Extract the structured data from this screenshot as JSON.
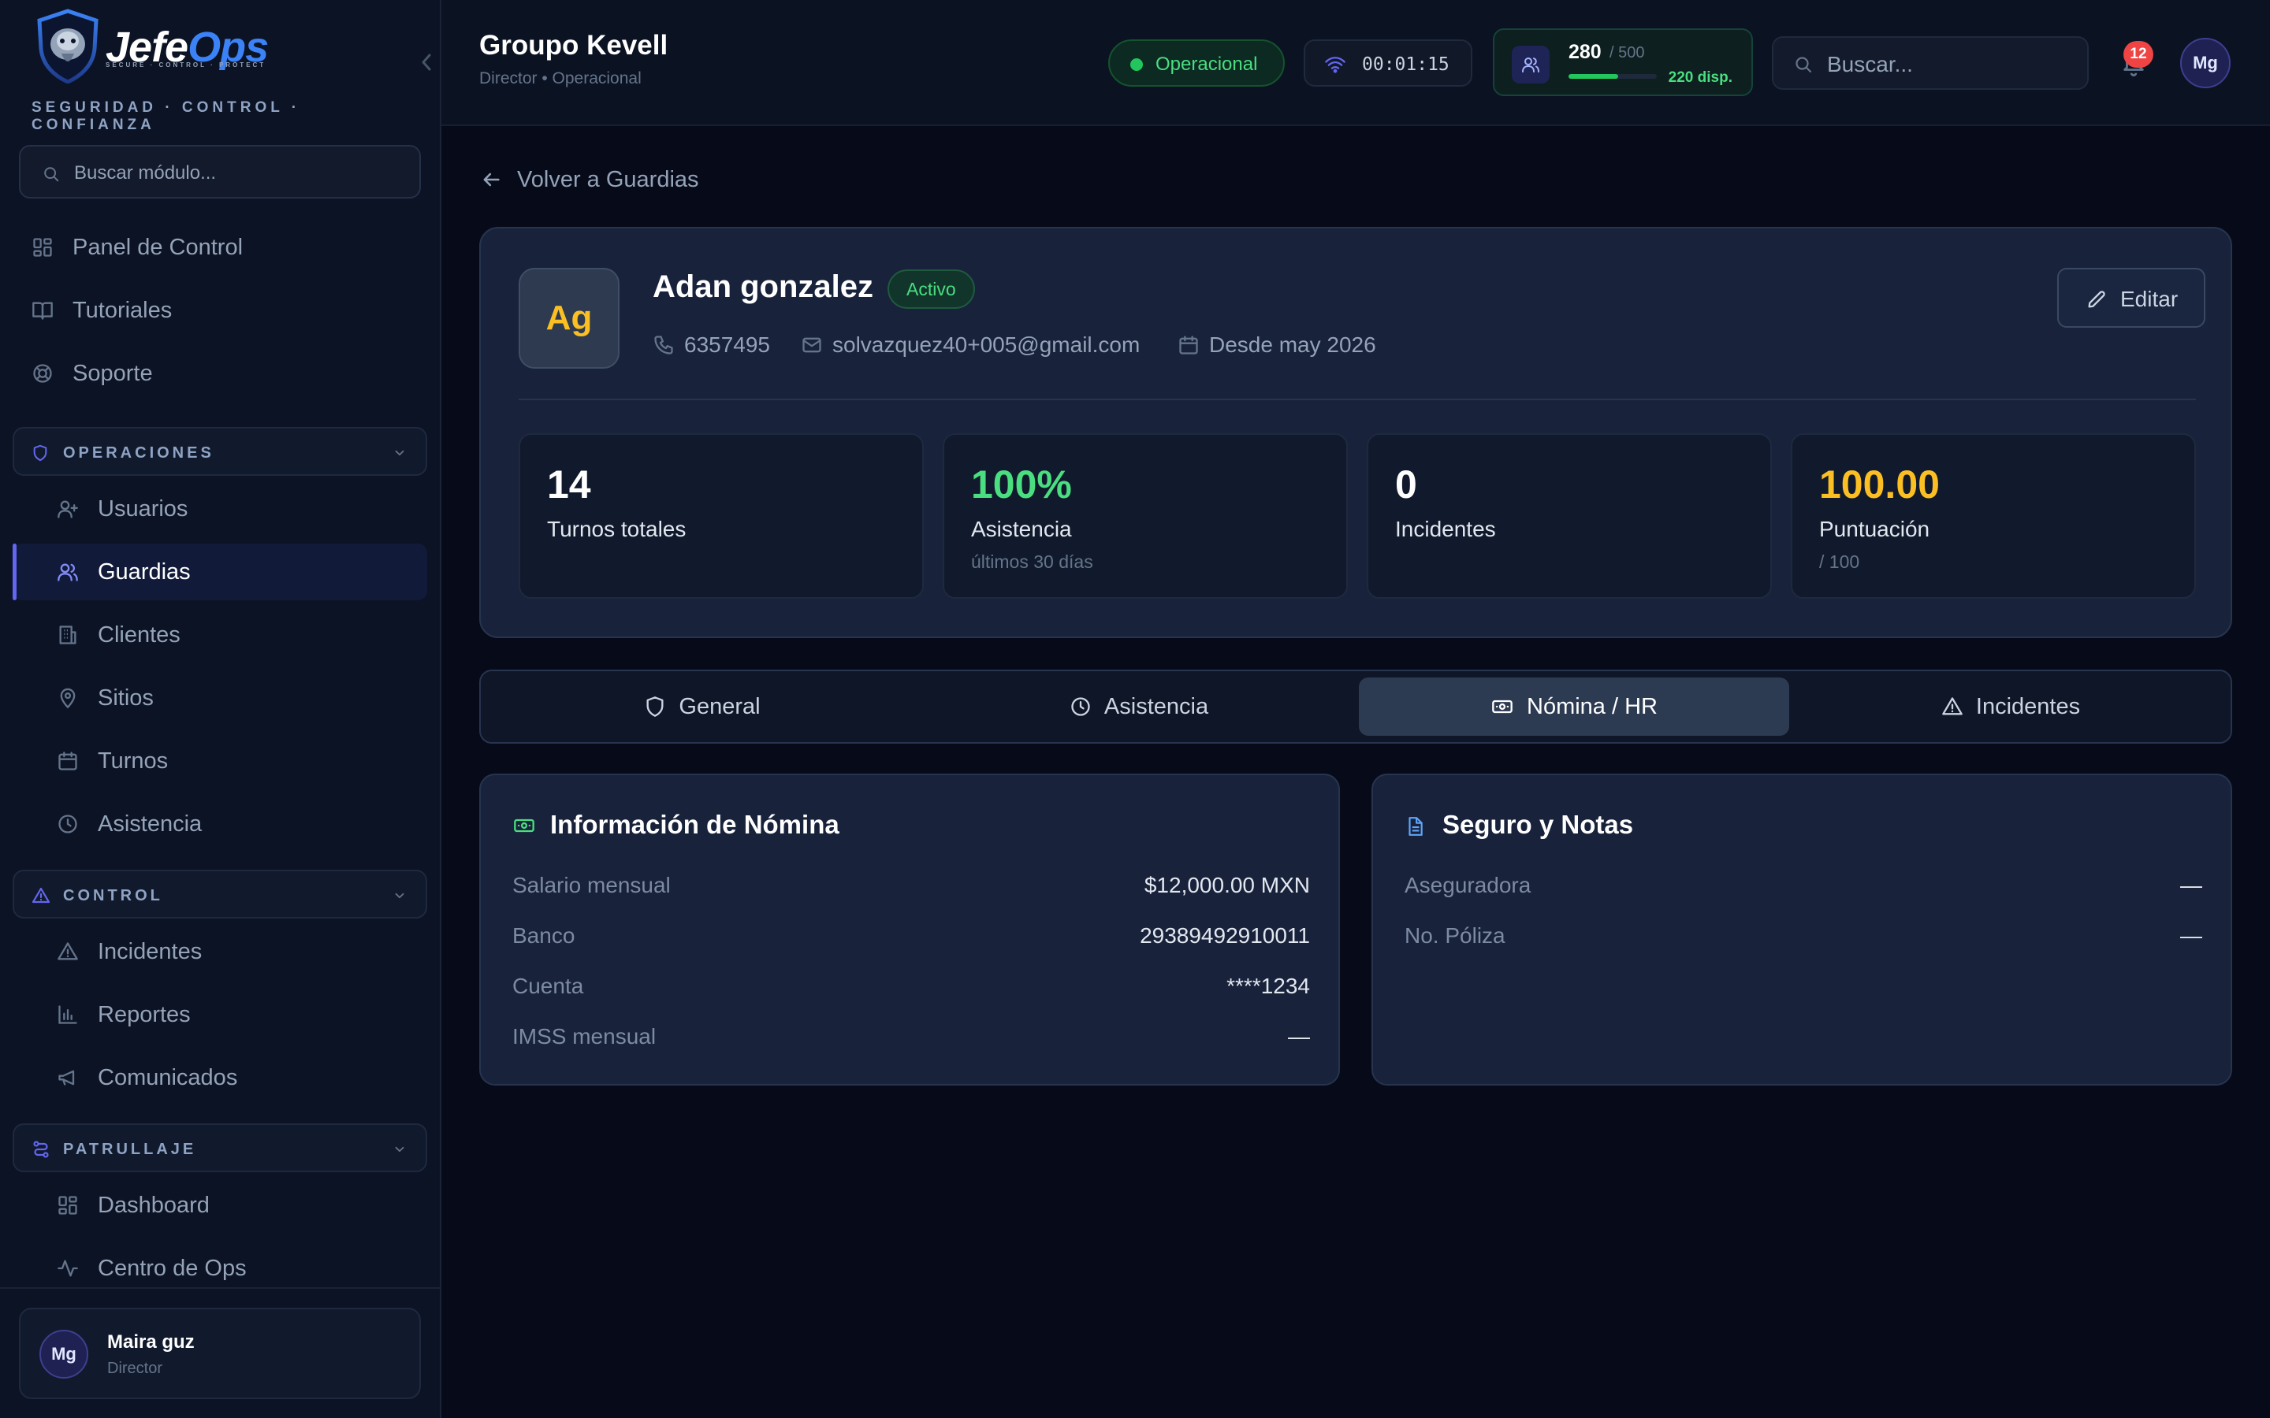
{
  "brand": {
    "name_part1": "Jefe",
    "name_part2": "Ops",
    "sub": "SECURE · CONTROL · PROTECT",
    "tagline": "SEGURIDAD · CONTROL · CONFIANZA"
  },
  "sidebar": {
    "search_placeholder": "Buscar módulo...",
    "top_items": [
      {
        "label": "Panel de Control",
        "icon": "grid-icon"
      },
      {
        "label": "Tutoriales",
        "icon": "book-icon"
      },
      {
        "label": "Soporte",
        "icon": "lifebuoy-icon"
      }
    ],
    "sections": [
      {
        "title": "OPERACIONES",
        "icon": "shield-icon",
        "items": [
          {
            "label": "Usuarios",
            "icon": "user-plus-icon"
          },
          {
            "label": "Guardias",
            "icon": "users-icon",
            "active": true
          },
          {
            "label": "Clientes",
            "icon": "building-icon"
          },
          {
            "label": "Sitios",
            "icon": "map-pin-icon"
          },
          {
            "label": "Turnos",
            "icon": "calendar-icon"
          },
          {
            "label": "Asistencia",
            "icon": "clock-icon"
          }
        ]
      },
      {
        "title": "CONTROL",
        "icon": "alert-triangle-icon",
        "items": [
          {
            "label": "Incidentes",
            "icon": "alert-triangle-icon"
          },
          {
            "label": "Reportes",
            "icon": "bar-chart-icon"
          },
          {
            "label": "Comunicados",
            "icon": "megaphone-icon"
          }
        ]
      },
      {
        "title": "PATRULLAJE",
        "icon": "route-icon",
        "items": [
          {
            "label": "Dashboard",
            "icon": "grid-icon"
          },
          {
            "label": "Centro de Ops",
            "icon": "activity-icon"
          }
        ]
      }
    ],
    "user": {
      "initials": "Mg",
      "name": "Maira guz",
      "role": "Director"
    }
  },
  "header": {
    "org_name": "Groupo Kevell",
    "org_sub": "Director • Operacional",
    "status": "Operacional",
    "timer": "00:01:15",
    "capacity": {
      "count": "280",
      "total": "/ 500",
      "available": "220 disp.",
      "fill_fraction": 0.56
    },
    "search_placeholder": "Buscar...",
    "notifications": "12",
    "user_initials": "Mg"
  },
  "colors": {
    "accent": "#6366f1",
    "success": "#4ade80",
    "warning": "#fbbf24",
    "danger": "#ef4444",
    "background": "#070b19",
    "card": "#18223a"
  },
  "main": {
    "back_label": "Volver a Guardias",
    "guard": {
      "initials": "Ag",
      "name": "Adan gonzalez",
      "status": "Activo",
      "phone": "6357495",
      "email": "solvazquez40+005@gmail.com",
      "since": "Desde may 2026"
    },
    "edit_label": "Editar",
    "stats": [
      {
        "value": "14",
        "label": "Turnos totales",
        "sub": "",
        "color": "#ffffff"
      },
      {
        "value": "100%",
        "label": "Asistencia",
        "sub": "últimos 30 días",
        "color": "#4ade80"
      },
      {
        "value": "0",
        "label": "Incidentes",
        "sub": "",
        "color": "#ffffff"
      },
      {
        "value": "100.00",
        "label": "Puntuación",
        "sub": "/ 100",
        "color": "#fbbf24"
      }
    ],
    "tabs": [
      {
        "label": "General",
        "icon": "shield-icon"
      },
      {
        "label": "Asistencia",
        "icon": "clock-icon"
      },
      {
        "label": "Nómina / HR",
        "icon": "cash-icon",
        "active": true
      },
      {
        "label": "Incidentes",
        "icon": "alert-triangle-icon"
      }
    ],
    "payroll": {
      "title": "Información de Nómina",
      "rows": [
        {
          "label": "Salario mensual",
          "value": "$12,000.00 MXN"
        },
        {
          "label": "Banco",
          "value": "29389492910011"
        },
        {
          "label": "Cuenta",
          "value": "****1234"
        },
        {
          "label": "IMSS mensual",
          "value": "—"
        }
      ]
    },
    "insurance": {
      "title": "Seguro y Notas",
      "rows": [
        {
          "label": "Aseguradora",
          "value": "—"
        },
        {
          "label": "No. Póliza",
          "value": "—"
        }
      ]
    }
  }
}
